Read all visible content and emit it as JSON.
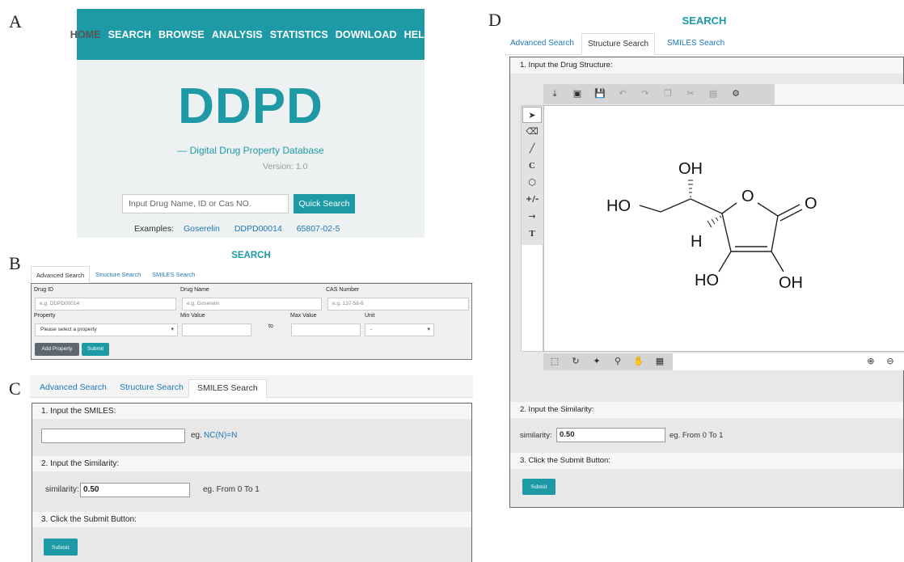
{
  "labels": {
    "a": "A",
    "b": "B",
    "c": "C",
    "d": "D"
  },
  "panel_a": {
    "nav": [
      "HOME",
      "SEARCH",
      "BROWSE",
      "ANALYSIS",
      "STATISTICS",
      "DOWNLOAD",
      "HELP"
    ],
    "logo": "DDPD",
    "subtitle": "— Digital Drug Property Database",
    "version": "Version: 1.0",
    "search_placeholder": "Input Drug Name, ID or Cas NO.",
    "quick_search_label": "Quick Search",
    "examples_label": "Examples:",
    "examples": [
      "Goserelin",
      "DDPD00014",
      "65807-02-5"
    ]
  },
  "panel_b": {
    "title": "SEARCH",
    "tabs": [
      "Advanced Search",
      "Structure Search",
      "SMILES Search"
    ],
    "drug_id_label": "Drug ID",
    "drug_id_placeholder": "e.g. DDPD00014",
    "drug_name_label": "Drug Name",
    "drug_name_placeholder": "e.g. Goserelin",
    "cas_label": "CAS Number",
    "cas_placeholder": "e.g. 137-58-6",
    "property_label": "Property",
    "property_select": "Please select a property",
    "min_label": "Min Value",
    "to_label": "to",
    "max_label": "Max Value",
    "unit_label": "Unit",
    "unit_select": "-",
    "add_property_label": "Add Property",
    "submit_label": "Submit"
  },
  "panel_c": {
    "tabs": [
      "Advanced Search",
      "Structure Search",
      "SMILES Search"
    ],
    "step1": "1. Input the SMILES:",
    "smiles_value": "",
    "smiles_eg_prefix": "eg.",
    "smiles_eg": "NC(N)=N",
    "step2": "2. Input the Similarity:",
    "similarity_label": "similarity:",
    "similarity_value": "0.50",
    "similarity_hint": "eg. From 0 To 1",
    "step3": "3. Click the Submit Button:",
    "submit_label": "Submit"
  },
  "panel_d": {
    "title": "SEARCH",
    "tabs": [
      "Advanced Search",
      "Structure Search",
      "SMILES Search"
    ],
    "step1": "1. Input the Drug Structure:",
    "step2": "2. Input the Similarity:",
    "similarity_label": "similarity:",
    "similarity_value": "0.50",
    "similarity_hint": "eg. From 0 To 1",
    "step3": "3. Click the Submit Button:",
    "submit_label": "Submit",
    "top_tools": [
      "new-icon",
      "open-icon",
      "save-icon",
      "undo-icon",
      "redo-icon",
      "copy-icon",
      "cut-icon",
      "paste-icon",
      "settings-icon"
    ],
    "left_tools": [
      "select-arrow-icon",
      "eraser-icon",
      "bond-icon",
      "chain-icon",
      "template-ring-icon",
      "charge-icon",
      "reaction-arrow-icon",
      "text-icon"
    ],
    "bottom_tools": [
      "rectangle-select-icon",
      "lasso-select-icon",
      "fragment-select-icon",
      "zoom-select-icon",
      "pan-hand-icon",
      "fit-icon"
    ],
    "atoms": {
      "oh_top": "OH",
      "ho_left": "HO",
      "o_ring": "O",
      "o_carbonyl": "O",
      "h": "H",
      "ho_bottom": "HO",
      "oh_bottom": "OH"
    }
  },
  "colors": {
    "brand": "#1e9aa6",
    "link": "#1e77b4"
  }
}
